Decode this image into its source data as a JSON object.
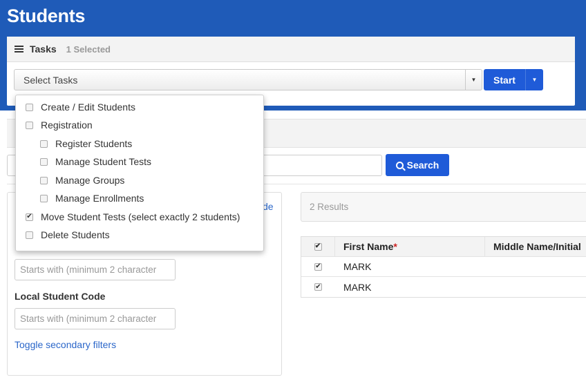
{
  "page": {
    "title": "Students"
  },
  "tasks": {
    "label": "Tasks",
    "selected_count": "1 Selected",
    "select_placeholder": "Select Tasks",
    "start_label": "Start",
    "menu": [
      {
        "label": "Create / Edit Students",
        "checked": false,
        "indent": 0
      },
      {
        "label": "Registration",
        "checked": false,
        "indent": 0
      },
      {
        "label": "Register Students",
        "checked": false,
        "indent": 1
      },
      {
        "label": "Manage Student Tests",
        "checked": false,
        "indent": 1
      },
      {
        "label": "Manage Groups",
        "checked": false,
        "indent": 1
      },
      {
        "label": "Manage Enrollments",
        "checked": false,
        "indent": 1
      },
      {
        "label": "Move Student Tests (select exactly 2 students)",
        "checked": true,
        "indent": 0
      },
      {
        "label": "Delete Students",
        "checked": false,
        "indent": 0
      }
    ]
  },
  "search": {
    "button_label": "Search"
  },
  "filters": {
    "partial_link": "de",
    "first_input_placeholder": "Starts with (minimum 2 character",
    "local_code_label": "Local Student Code",
    "local_code_placeholder": "Starts with (minimum 2 character",
    "toggle_label": "Toggle secondary filters"
  },
  "results": {
    "count_text": "2 Results",
    "columns": [
      "First Name",
      "Middle Name/Initial"
    ],
    "required_marker": "*",
    "rows": [
      {
        "first_name": "MARK",
        "checked": true
      },
      {
        "first_name": "MARK",
        "checked": true
      }
    ],
    "header_checked": true
  },
  "colors": {
    "header_blue": "#1f5bb8",
    "button_blue": "#1f5bd8",
    "link_blue": "#2a66c9"
  }
}
